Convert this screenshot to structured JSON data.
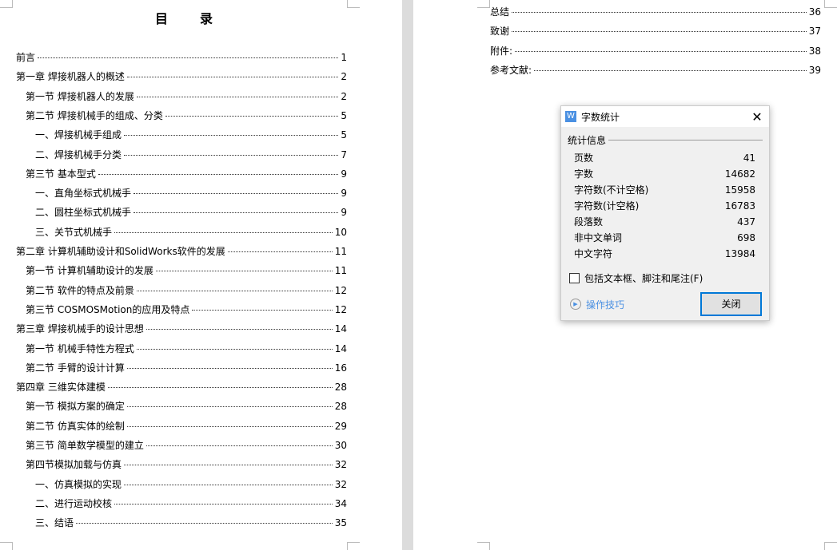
{
  "left_page": {
    "title": "目录",
    "entries": [
      {
        "label": "前言",
        "page": "1",
        "level": 1
      },
      {
        "label": "第一章 焊接机器人的概述",
        "page": "2",
        "level": 1
      },
      {
        "label": "第一节 焊接机器人的发展",
        "page": "2",
        "level": 2
      },
      {
        "label": "第二节 焊接机械手的组成、分类",
        "page": "5",
        "level": 2
      },
      {
        "label": "一、焊接机械手组成",
        "page": "5",
        "level": 3
      },
      {
        "label": "二、焊接机械手分类",
        "page": "7",
        "level": 3
      },
      {
        "label": "第三节 基本型式",
        "page": "9",
        "level": 2
      },
      {
        "label": "一、直角坐标式机械手",
        "page": "9",
        "level": 3
      },
      {
        "label": "二、圆柱坐标式机械手",
        "page": "9",
        "level": 3
      },
      {
        "label": "三、关节式机械手",
        "page": "10",
        "level": 3
      },
      {
        "label": "第二章 计算机辅助设计和SolidWorks软件的发展",
        "page": "11",
        "level": 1
      },
      {
        "label": "第一节 计算机辅助设计的发展",
        "page": "11",
        "level": 2
      },
      {
        "label": "第二节 软件的特点及前景",
        "page": "12",
        "level": 2
      },
      {
        "label": "第三节 COSMOSMotion的应用及特点",
        "page": "12",
        "level": 2
      },
      {
        "label": "第三章 焊接机械手的设计思想",
        "page": "14",
        "level": 1
      },
      {
        "label": "第一节 机械手特性方程式",
        "page": "14",
        "level": 2
      },
      {
        "label": "第二节 手臂的设计计算",
        "page": "16",
        "level": 2
      },
      {
        "label": "第四章 三维实体建模",
        "page": "28",
        "level": 1
      },
      {
        "label": "第一节 模拟方案的确定",
        "page": "28",
        "level": 2
      },
      {
        "label": "第二节 仿真实体的绘制",
        "page": "29",
        "level": 2
      },
      {
        "label": "第三节 简单数学模型的建立",
        "page": "30",
        "level": 2
      },
      {
        "label": "第四节模拟加载与仿真",
        "page": "32",
        "level": 2
      },
      {
        "label": "一、仿真模拟的实现",
        "page": "32",
        "level": 3
      },
      {
        "label": "二、进行运动校核",
        "page": "34",
        "level": 3
      },
      {
        "label": "三、结语",
        "page": "35",
        "level": 3
      }
    ]
  },
  "right_page": {
    "entries": [
      {
        "label": "总结",
        "page": "36"
      },
      {
        "label": "致谢",
        "page": "37"
      },
      {
        "label": "附件:",
        "page": "38"
      },
      {
        "label": "参考文献:",
        "page": "39"
      }
    ]
  },
  "dialog": {
    "title": "字数统计",
    "icon_letter": "W",
    "section": "统计信息",
    "stats": [
      {
        "label": "页数",
        "value": "41"
      },
      {
        "label": "字数",
        "value": "14682"
      },
      {
        "label": "字符数(不计空格)",
        "value": "15958"
      },
      {
        "label": "字符数(计空格)",
        "value": "16783"
      },
      {
        "label": "段落数",
        "value": "437"
      },
      {
        "label": "非中文单词",
        "value": "698"
      },
      {
        "label": "中文字符",
        "value": "13984"
      }
    ],
    "checkbox_label": "包括文本框、脚注和尾注(F)",
    "checkbox_checked": false,
    "tips_label": "操作技巧",
    "close_label": "关闭"
  }
}
